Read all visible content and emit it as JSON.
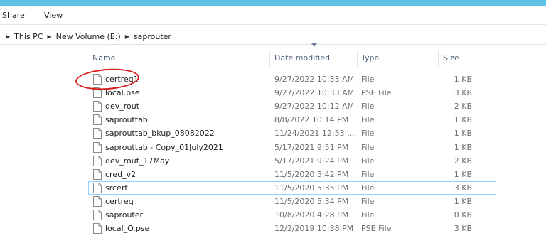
{
  "ribbon": {
    "tabs": [
      "Share",
      "View"
    ]
  },
  "address": {
    "path": [
      "This PC",
      "New Volume (E:)",
      "saprouter"
    ]
  },
  "columns": {
    "name": "Name",
    "date": "Date modified",
    "type": "Type",
    "size": "Size"
  },
  "files": [
    {
      "name": "certreq1",
      "date": "9/27/2022 10:33 AM",
      "type": "File",
      "size": "1 KB"
    },
    {
      "name": "local.pse",
      "date": "9/27/2022 10:33 AM",
      "type": "PSE File",
      "size": "3 KB"
    },
    {
      "name": "dev_rout",
      "date": "9/27/2022 10:12 AM",
      "type": "File",
      "size": "2 KB"
    },
    {
      "name": "saprouttab",
      "date": "8/8/2022 10:14 PM",
      "type": "File",
      "size": "1 KB"
    },
    {
      "name": "saprouttab_bkup_08082022",
      "date": "11/24/2021 12:53 ...",
      "type": "File",
      "size": "1 KB"
    },
    {
      "name": "saprouttab - Copy_01July2021",
      "date": "5/17/2021 9:51 PM",
      "type": "File",
      "size": "1 KB"
    },
    {
      "name": "dev_rout_17May",
      "date": "5/17/2021 9:24 PM",
      "type": "File",
      "size": "2 KB"
    },
    {
      "name": "cred_v2",
      "date": "11/5/2020 5:42 PM",
      "type": "File",
      "size": "1 KB"
    },
    {
      "name": "srcert",
      "date": "11/5/2020 5:35 PM",
      "type": "File",
      "size": "3 KB"
    },
    {
      "name": "certreq",
      "date": "11/5/2020 5:34 PM",
      "type": "File",
      "size": "1 KB"
    },
    {
      "name": "saprouter",
      "date": "10/8/2020 4:28 PM",
      "type": "File",
      "size": "0 KB"
    },
    {
      "name": "local_O.pse",
      "date": "12/2/2019 10:38 PM",
      "type": "PSE File",
      "size": "3 KB"
    }
  ],
  "focused_row_index": 8,
  "highlighted_row_index": 0,
  "colors": {
    "accent": "#5ec1e8",
    "highlight": "#d62020",
    "focus": "#99d1ff",
    "header_text": "#4c607a"
  },
  "icons": {
    "file": "file-icon",
    "breadcrumb_separator": "chevron-right-icon",
    "sort": "sort-down-icon"
  }
}
